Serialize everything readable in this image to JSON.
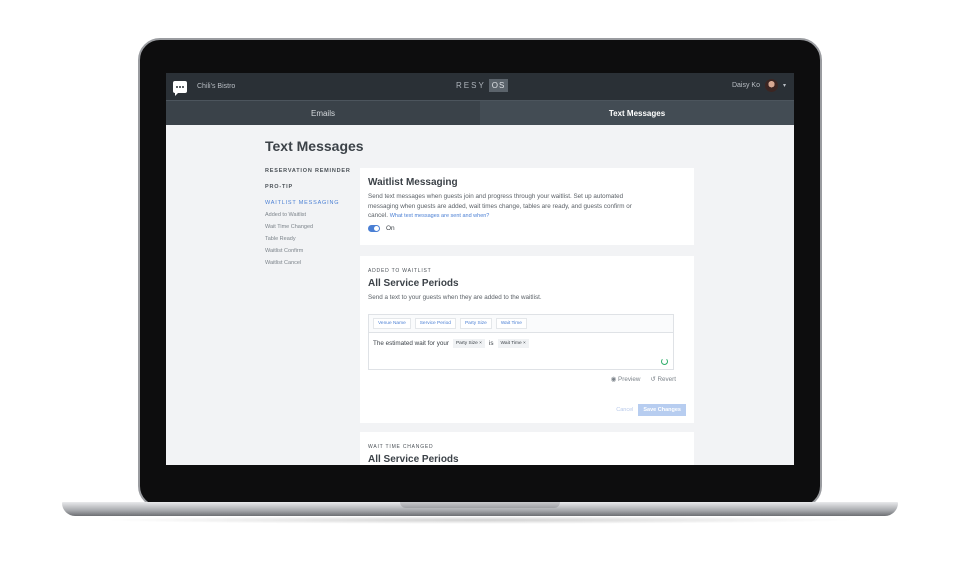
{
  "topbar": {
    "venue": "Chili's Bistro",
    "brand_left": "RESY",
    "brand_right": "OS",
    "user_name": "Daisy Ko"
  },
  "tabs": [
    {
      "label": "Emails"
    },
    {
      "label": "Text Messages"
    }
  ],
  "page_title": "Text Messages",
  "sidebar": {
    "heading1": "RESERVATION REMINDER",
    "heading2": "PRO-TIP",
    "items": [
      {
        "label": "WAITLIST MESSAGING"
      },
      {
        "label": "Added to Waitlist"
      },
      {
        "label": "Wait Time Changed"
      },
      {
        "label": "Table Ready"
      },
      {
        "label": "Waitlist Confirm"
      },
      {
        "label": "Waitlist Cancel"
      }
    ]
  },
  "waitlist_card": {
    "title": "Waitlist Messaging",
    "description": "Send text messages when guests join and progress through your waitlist. Set up automated messaging when guests are added, wait times change, tables are ready, and guests confirm or cancel.",
    "link": "What text messages are sent and when?",
    "toggle_label": "On"
  },
  "added_card": {
    "eyebrow": "ADDED TO WAITLIST",
    "title": "All Service Periods",
    "description": "Send a text to your guests when they are added to the waitlist.",
    "tokens": [
      "Venue Name",
      "Service Period",
      "Party Size",
      "Wait Time"
    ],
    "message_prefix": "The estimated wait for your",
    "message_chip1": "Party Size",
    "message_connector": "is",
    "message_chip2": "Wait Time",
    "preview_label": "Preview",
    "revert_label": "Revert",
    "cancel_label": "Cancel",
    "save_label": "Save Changes"
  },
  "wait_card": {
    "eyebrow": "WAIT TIME CHANGED",
    "title": "All Service Periods"
  }
}
